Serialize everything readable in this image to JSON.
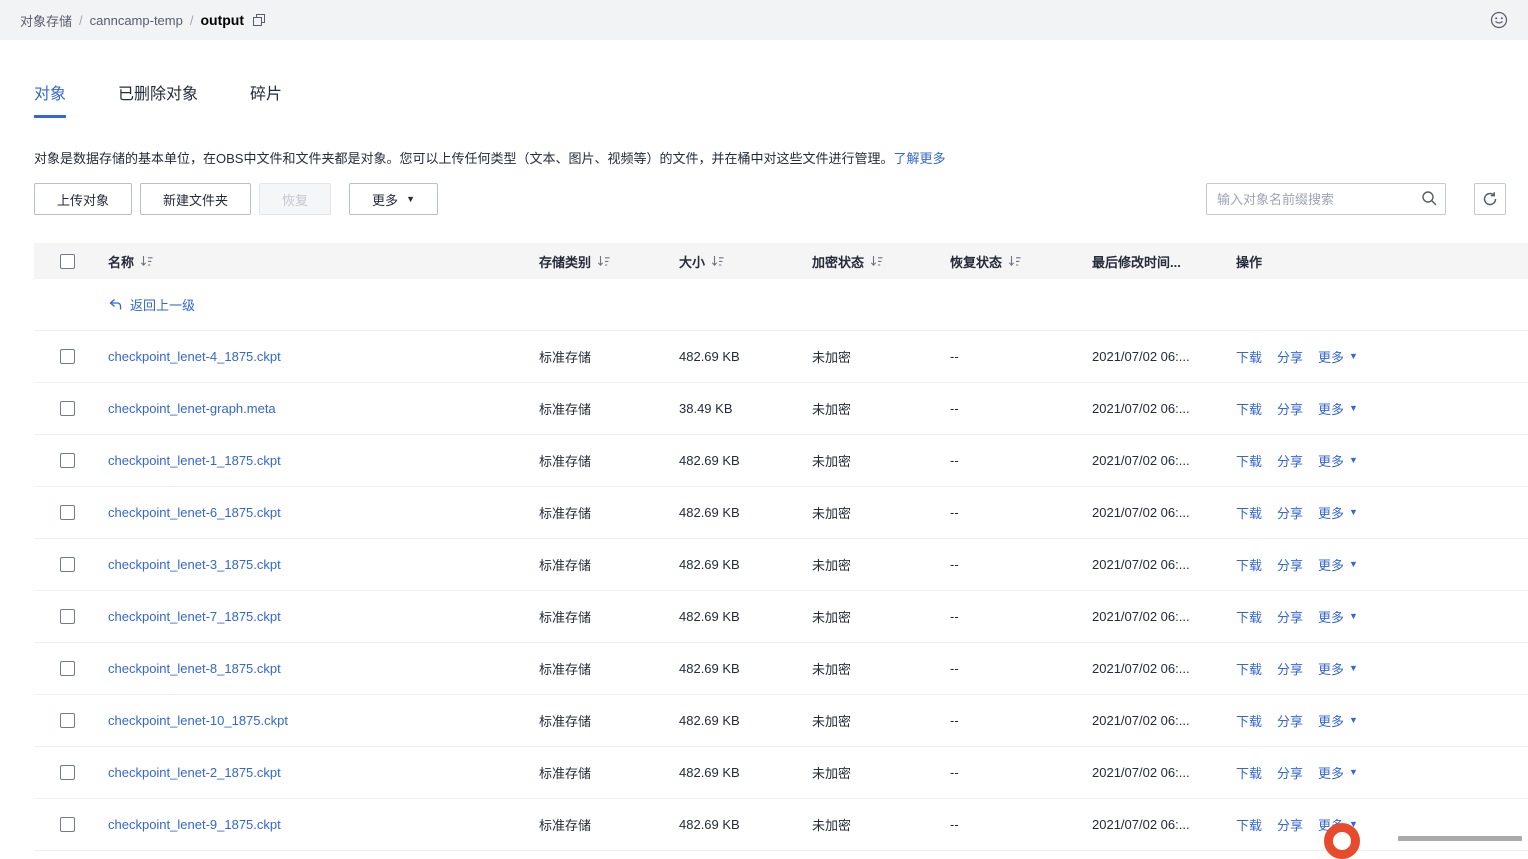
{
  "colors": {
    "accent": "#3366d6",
    "watermark_orange": "#e84a2c"
  },
  "topbar": {
    "breadcrumb": [
      {
        "label": "对象存储"
      },
      {
        "label": "canncamp-temp"
      },
      {
        "label": "output"
      }
    ],
    "icons": [
      "copy-icon",
      "smiley-feedback-icon"
    ]
  },
  "tabs": [
    {
      "label": "对象",
      "active": true
    },
    {
      "label": "已删除对象",
      "active": false
    },
    {
      "label": "碎片",
      "active": false
    }
  ],
  "intro": {
    "text": "对象是数据存储的基本单位，在OBS中文件和文件夹都是对象。您可以上传任何类型（文本、图片、视频等）的文件，并在桶中对这些文件进行管理。",
    "link": "了解更多"
  },
  "toolbar": {
    "upload_label": "上传对象",
    "new_folder_label": "新建文件夹",
    "restore_label": "恢复",
    "more_label": "更多",
    "search_placeholder": "输入对象名前缀搜索"
  },
  "table": {
    "headers": [
      {
        "label": "名称",
        "sortable": true
      },
      {
        "label": "存储类别",
        "sortable": true
      },
      {
        "label": "大小",
        "sortable": true
      },
      {
        "label": "加密状态",
        "sortable": true
      },
      {
        "label": "恢复状态",
        "sortable": true
      },
      {
        "label": "最后修改时间...",
        "sortable": false
      },
      {
        "label": "操作",
        "sortable": false
      }
    ],
    "back_link": "返回上一级",
    "row_actions": [
      "下载",
      "分享",
      "更多"
    ],
    "rows": [
      {
        "name": "checkpoint_lenet-4_1875.ckpt",
        "storage_class": "标准存储",
        "size": "482.69 KB",
        "encryption": "未加密",
        "restore_status": "--",
        "modified": "2021/07/02 06:..."
      },
      {
        "name": "checkpoint_lenet-graph.meta",
        "storage_class": "标准存储",
        "size": "38.49 KB",
        "encryption": "未加密",
        "restore_status": "--",
        "modified": "2021/07/02 06:..."
      },
      {
        "name": "checkpoint_lenet-1_1875.ckpt",
        "storage_class": "标准存储",
        "size": "482.69 KB",
        "encryption": "未加密",
        "restore_status": "--",
        "modified": "2021/07/02 06:..."
      },
      {
        "name": "checkpoint_lenet-6_1875.ckpt",
        "storage_class": "标准存储",
        "size": "482.69 KB",
        "encryption": "未加密",
        "restore_status": "--",
        "modified": "2021/07/02 06:..."
      },
      {
        "name": "checkpoint_lenet-3_1875.ckpt",
        "storage_class": "标准存储",
        "size": "482.69 KB",
        "encryption": "未加密",
        "restore_status": "--",
        "modified": "2021/07/02 06:..."
      },
      {
        "name": "checkpoint_lenet-7_1875.ckpt",
        "storage_class": "标准存储",
        "size": "482.69 KB",
        "encryption": "未加密",
        "restore_status": "--",
        "modified": "2021/07/02 06:..."
      },
      {
        "name": "checkpoint_lenet-8_1875.ckpt",
        "storage_class": "标准存储",
        "size": "482.69 KB",
        "encryption": "未加密",
        "restore_status": "--",
        "modified": "2021/07/02 06:..."
      },
      {
        "name": "checkpoint_lenet-10_1875.ckpt",
        "storage_class": "标准存储",
        "size": "482.69 KB",
        "encryption": "未加密",
        "restore_status": "--",
        "modified": "2021/07/02 06:..."
      },
      {
        "name": "checkpoint_lenet-2_1875.ckpt",
        "storage_class": "标准存储",
        "size": "482.69 KB",
        "encryption": "未加密",
        "restore_status": "--",
        "modified": "2021/07/02 06:..."
      },
      {
        "name": "checkpoint_lenet-9_1875.ckpt",
        "storage_class": "标准存储",
        "size": "482.69 KB",
        "encryption": "未加密",
        "restore_status": "--",
        "modified": "2021/07/02 06:..."
      }
    ]
  }
}
